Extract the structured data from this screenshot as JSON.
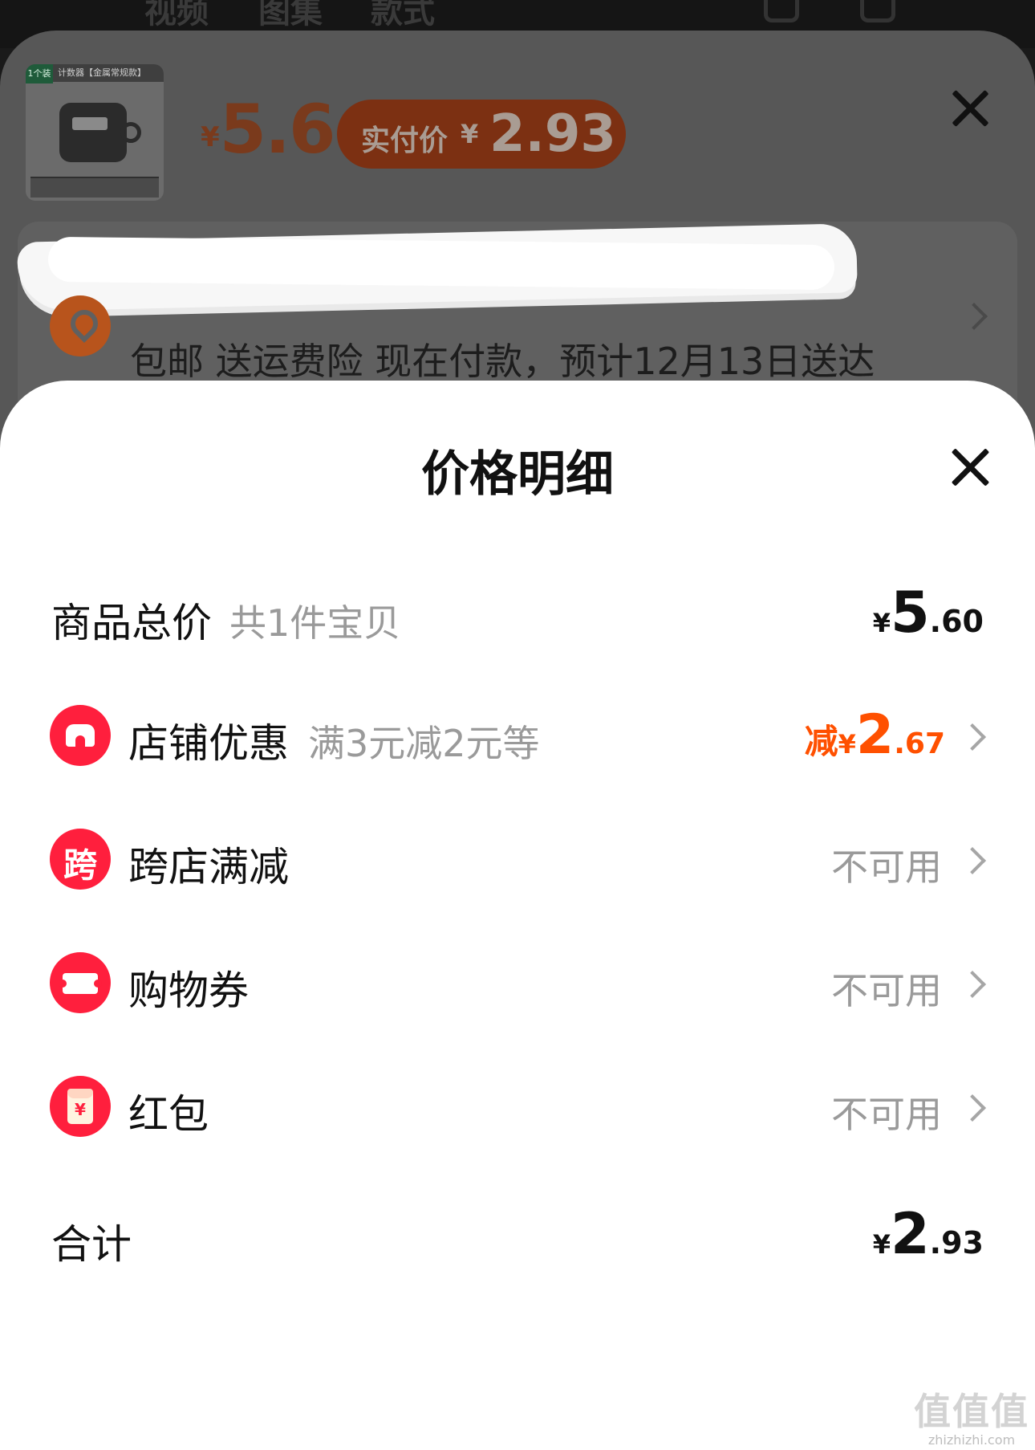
{
  "background": {
    "tabs": [
      "视频",
      "图集",
      "款式"
    ],
    "product_thumb": {
      "badge": "1个装",
      "caption": "计数器【金属常规款】"
    },
    "price": {
      "yen": "¥",
      "value": "5.6"
    },
    "paid_price": {
      "label": "实付价",
      "yen": "¥",
      "value": "2.93"
    },
    "shipping_text": "包邮 送运费险 现在付款，预计12月13日送达"
  },
  "sheet": {
    "title": "价格明细",
    "rows": {
      "total_goods": {
        "label": "商品总价",
        "sub": "共1件宝贝",
        "yen": "¥",
        "int": "5",
        "dec": ".60"
      },
      "shop_discount": {
        "label": "店铺优惠",
        "sub": "满3元减2元等",
        "prefix": "减",
        "yen": "¥",
        "int": "2",
        "dec": ".67",
        "icon": "shop-icon"
      },
      "cross_store": {
        "label": "跨店满减",
        "status": "不可用",
        "icon_char": "跨",
        "icon": "cross-store-icon"
      },
      "shopping_coupon": {
        "label": "购物券",
        "status": "不可用",
        "icon": "ticket-icon"
      },
      "red_packet": {
        "label": "红包",
        "status": "不可用",
        "icon_char": "¥",
        "icon": "red-packet-icon"
      },
      "total": {
        "label": "合计",
        "yen": "¥",
        "int": "2",
        "dec": ".93"
      }
    }
  },
  "watermark": {
    "big": "值值值",
    "small": "zhizhizhi.com"
  },
  "colors": {
    "accent_red": "#ff1f3d",
    "discount_orange": "#ff5000",
    "muted_text": "#9a9a9a",
    "overlay_dim": "#575757"
  }
}
